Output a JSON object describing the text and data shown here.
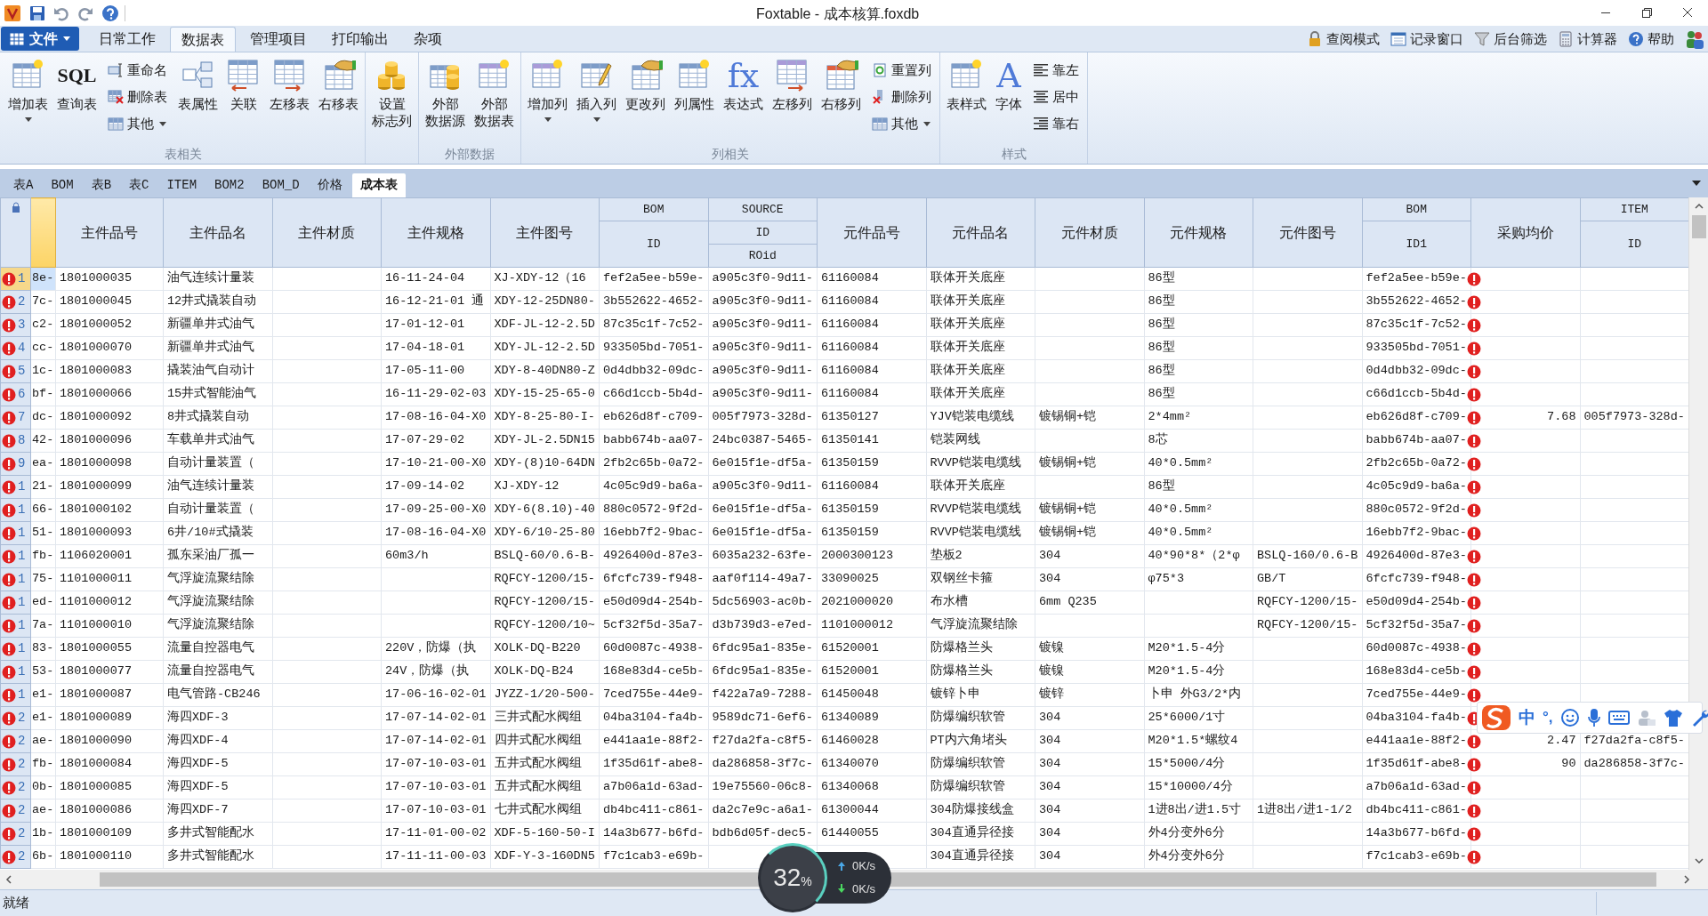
{
  "window": {
    "title": "Foxtable - 成本核算.foxdb"
  },
  "menu": {
    "file": "文件",
    "tabs": [
      {
        "label": "日常工作",
        "selected": false
      },
      {
        "label": "数据表",
        "selected": true
      },
      {
        "label": "管理项目",
        "selected": false
      },
      {
        "label": "打印输出",
        "selected": false
      },
      {
        "label": "杂项",
        "selected": false
      }
    ],
    "tools": [
      "查阅模式",
      "记录窗口",
      "后台筛选",
      "计算器",
      "帮助"
    ]
  },
  "ribbon": {
    "groups": [
      {
        "label": "表相关",
        "items": [
          {
            "kind": "large",
            "lines": [
              "增加表"
            ],
            "dropdown": true
          },
          {
            "kind": "large",
            "lines": [
              "查询表"
            ],
            "glyph": "SQL",
            "dropdown": false
          },
          {
            "kind": "stack",
            "items": [
              {
                "label": "重命名",
                "dropdown": false
              },
              {
                "label": "删除表",
                "dropdown": false
              },
              {
                "label": "其他",
                "dropdown": true
              }
            ]
          },
          {
            "kind": "large",
            "lines": [
              "表属性"
            ],
            "dropdown": false
          },
          {
            "kind": "large",
            "lines": [
              "关联"
            ],
            "dropdown": false
          },
          {
            "kind": "large",
            "lines": [
              "左移表"
            ],
            "dropdown": false
          },
          {
            "kind": "large",
            "lines": [
              "右移表"
            ],
            "dropdown": false
          }
        ]
      },
      {
        "items": [
          {
            "kind": "large",
            "lines": [
              "设置",
              "标志列"
            ],
            "dropdown": false
          }
        ]
      },
      {
        "label": "外部数据",
        "items": [
          {
            "kind": "large",
            "lines": [
              "外部",
              "数据源"
            ],
            "dropdown": false
          },
          {
            "kind": "large",
            "lines": [
              "外部",
              "数据表"
            ],
            "dropdown": false
          }
        ]
      },
      {
        "label": "列相关",
        "items": [
          {
            "kind": "large",
            "lines": [
              "增加列"
            ],
            "dropdown": true
          },
          {
            "kind": "large",
            "lines": [
              "插入列"
            ],
            "dropdown": true
          },
          {
            "kind": "large",
            "lines": [
              "更改列"
            ],
            "dropdown": false
          },
          {
            "kind": "large",
            "lines": [
              "列属性"
            ],
            "dropdown": false
          },
          {
            "kind": "large",
            "lines": [
              "表达式"
            ],
            "glyph": "fx",
            "dropdown": false
          },
          {
            "kind": "large",
            "lines": [
              "左移列"
            ],
            "dropdown": false
          },
          {
            "kind": "large",
            "lines": [
              "右移列"
            ],
            "dropdown": false
          },
          {
            "kind": "stack",
            "items": [
              {
                "label": "重置列",
                "dropdown": false
              },
              {
                "label": "删除列",
                "dropdown": false
              },
              {
                "label": "其他",
                "dropdown": true
              }
            ]
          }
        ]
      },
      {
        "label": "样式",
        "items": [
          {
            "kind": "large",
            "lines": [
              "表样式"
            ],
            "dropdown": false
          },
          {
            "kind": "large",
            "lines": [
              "字体"
            ],
            "glyph": "A",
            "dropdown": false
          },
          {
            "kind": "stack",
            "items": [
              {
                "label": "靠左",
                "dropdown": false
              },
              {
                "label": "居中",
                "dropdown": false
              },
              {
                "label": "靠右",
                "dropdown": false
              }
            ]
          }
        ]
      }
    ]
  },
  "sheet_tabs": [
    {
      "label": "表A",
      "selected": false
    },
    {
      "label": "BOM",
      "selected": false
    },
    {
      "label": "表B",
      "selected": false
    },
    {
      "label": "表C",
      "selected": false
    },
    {
      "label": "ITEM",
      "selected": false
    },
    {
      "label": "BOM2",
      "selected": false
    },
    {
      "label": "BOM_D",
      "selected": false
    },
    {
      "label": "价格",
      "selected": false
    },
    {
      "label": "成本表",
      "selected": true
    }
  ],
  "table": {
    "columns": [
      {
        "selected": true
      },
      {
        "label": "主件品号",
        "selected": false
      },
      {
        "label": "主件品名",
        "selected": false
      },
      {
        "label": "主件材质",
        "selected": false
      },
      {
        "label": "主件规格",
        "selected": false
      },
      {
        "label": "主件图号",
        "selected": false
      },
      {
        "group": "BOM",
        "label": "ID",
        "selected": false
      },
      {
        "group": "SOURCE",
        "label": "ID",
        "sublabel": "ROid",
        "selected": false
      },
      {
        "label": "元件品号",
        "selected": false
      },
      {
        "label": "元件品名",
        "selected": false
      },
      {
        "label": "元件材质",
        "selected": false
      },
      {
        "label": "元件规格",
        "selected": false
      },
      {
        "label": "元件图号",
        "selected": false
      },
      {
        "group": "BOM",
        "label": "ID1",
        "selected": false
      },
      {
        "label": "采购均价",
        "selected": false
      },
      {
        "group": "ITEM",
        "label": "ID",
        "selected": false
      }
    ],
    "rows": [
      {
        "num": "1",
        "selected": true,
        "invalid": true,
        "cells": [
          "8e-",
          "1801000035",
          "油气连续计量装",
          null,
          "16-11-24-04",
          "XJ-XDY-12（16",
          "fef2a5ee-b59e-",
          "a905c3f0-9d11-",
          "61160084",
          "联体开关底座",
          null,
          "86型",
          null,
          "fef2a5ee-b59e-",
          null,
          null
        ]
      },
      {
        "num": "2",
        "selected": false,
        "invalid": true,
        "cells": [
          "7c-",
          "1801000045",
          "12井式撬装自动",
          null,
          "16-12-21-01 通",
          "XDY-12-25DN80-",
          "3b552622-4652-",
          "a905c3f0-9d11-",
          "61160084",
          "联体开关底座",
          null,
          "86型",
          null,
          "3b552622-4652-",
          null,
          null
        ]
      },
      {
        "num": "3",
        "selected": false,
        "invalid": true,
        "cells": [
          "c2-",
          "1801000052",
          "新疆单井式油气",
          null,
          "17-01-12-01",
          "XDF-JL-12-2.5D",
          "87c35c1f-7c52-",
          "a905c3f0-9d11-",
          "61160084",
          "联体开关底座",
          null,
          "86型",
          null,
          "87c35c1f-7c52-",
          null,
          null
        ]
      },
      {
        "num": "4",
        "selected": false,
        "invalid": true,
        "cells": [
          "cc-",
          "1801000070",
          "新疆单井式油气",
          null,
          "17-04-18-01",
          "XDY-JL-12-2.5D",
          "933505bd-7051-",
          "a905c3f0-9d11-",
          "61160084",
          "联体开关底座",
          null,
          "86型",
          null,
          "933505bd-7051-",
          null,
          null
        ]
      },
      {
        "num": "5",
        "selected": false,
        "invalid": true,
        "cells": [
          "1c-",
          "1801000083",
          "撬装油气自动计",
          null,
          "17-05-11-00",
          "XDY-8-40DN80-Z",
          "0d4dbb32-09dc-",
          "a905c3f0-9d11-",
          "61160084",
          "联体开关底座",
          null,
          "86型",
          null,
          "0d4dbb32-09dc-",
          null,
          null
        ]
      },
      {
        "num": "6",
        "selected": false,
        "invalid": true,
        "cells": [
          "bf-",
          "1801000066",
          "15井式智能油气",
          null,
          "16-11-29-02-03",
          "XDY-15-25-65-0",
          "c66d1ccb-5b4d-",
          "a905c3f0-9d11-",
          "61160084",
          "联体开关底座",
          null,
          "86型",
          null,
          "c66d1ccb-5b4d-",
          null,
          null
        ]
      },
      {
        "num": "7",
        "selected": false,
        "invalid": true,
        "cells": [
          "dc-",
          "1801000092",
          "8井式撬装自动",
          null,
          "17-08-16-04-X0",
          "XDY-8-25-80-I-",
          "eb626d8f-c709-",
          "005f7973-328d-",
          "61350127",
          "YJV铠装电缆线",
          "镀锡铜+铠",
          "2*4mm²",
          null,
          "eb626d8f-c709-",
          "7.68",
          "005f7973-328d-"
        ]
      },
      {
        "num": "8",
        "selected": false,
        "invalid": true,
        "cells": [
          "42-",
          "1801000096",
          "车载单井式油气",
          null,
          "17-07-29-02",
          "XDY-JL-2.5DN15",
          "babb674b-aa07-",
          "24bc0387-5465-",
          "61350141",
          "铠装网线",
          null,
          "8芯",
          null,
          "babb674b-aa07-",
          null,
          null
        ]
      },
      {
        "num": "9",
        "selected": false,
        "invalid": true,
        "cells": [
          "ea-",
          "1801000098",
          "自动计量装置（",
          null,
          "17-10-21-00-X0",
          "XDY-(8)10-64DN",
          "2fb2c65b-0a72-",
          "6e015f1e-df5a-",
          "61350159",
          "RVVP铠装电缆线",
          "镀锡铜+铠",
          "40*0.5mm²",
          null,
          "2fb2c65b-0a72-",
          null,
          null
        ]
      },
      {
        "num": "1",
        "selected": false,
        "invalid": true,
        "cells": [
          "21-",
          "1801000099",
          "油气连续计量装",
          null,
          "17-09-14-02",
          "XJ-XDY-12",
          "4c05c9d9-ba6a-",
          "a905c3f0-9d11-",
          "61160084",
          "联体开关底座",
          null,
          "86型",
          null,
          "4c05c9d9-ba6a-",
          null,
          null
        ]
      },
      {
        "num": "1",
        "selected": false,
        "invalid": true,
        "cells": [
          "66-",
          "1801000102",
          "自动计量装置（",
          null,
          "17-09-25-00-X0",
          "XDY-6(8.10)-40",
          "880c0572-9f2d-",
          "6e015f1e-df5a-",
          "61350159",
          "RVVP铠装电缆线",
          "镀锡铜+铠",
          "40*0.5mm²",
          null,
          "880c0572-9f2d-",
          null,
          null
        ]
      },
      {
        "num": "1",
        "selected": false,
        "invalid": true,
        "cells": [
          "51-",
          "1801000093",
          "6井/10#式撬装",
          null,
          "17-08-16-04-X0",
          "XDY-6/10-25-80",
          "16ebb7f2-9bac-",
          "6e015f1e-df5a-",
          "61350159",
          "RVVP铠装电缆线",
          "镀锡铜+铠",
          "40*0.5mm²",
          null,
          "16ebb7f2-9bac-",
          null,
          null
        ]
      },
      {
        "num": "1",
        "selected": false,
        "invalid": true,
        "cells": [
          "fb-",
          "1106020001",
          "孤东采油厂孤一",
          null,
          "60m3/h",
          "BSLQ-60/0.6-B-",
          "4926400d-87e3-",
          "6035a232-63fe-",
          "2000300123",
          "垫板2",
          "304",
          "40*90*8*（2*φ",
          "BSLQ-160/0.6-B",
          "4926400d-87e3-",
          null,
          null
        ]
      },
      {
        "num": "1",
        "selected": false,
        "invalid": true,
        "cells": [
          "75-",
          "1101000011",
          "气浮旋流聚结除",
          null,
          null,
          "RQFCY-1200/15-",
          "6fcfc739-f948-",
          "aaf0f114-49a7-",
          "33090025",
          "双钢丝卡箍",
          "304",
          "φ75*3",
          "GB/T",
          "6fcfc739-f948-",
          null,
          null
        ]
      },
      {
        "num": "1",
        "selected": false,
        "invalid": true,
        "cells": [
          "ed-",
          "1101000012",
          "气浮旋流聚结除",
          null,
          null,
          "RQFCY-1200/15-",
          "e50d09d4-254b-",
          "5dc56903-ac0b-",
          "2021000020",
          "布水槽",
          "6mm Q235",
          null,
          "RQFCY-1200/15-",
          "e50d09d4-254b-",
          null,
          null
        ]
      },
      {
        "num": "1",
        "selected": false,
        "invalid": true,
        "cells": [
          "7a-",
          "1101000010",
          "气浮旋流聚结除",
          null,
          null,
          "RQFCY-1200/10~",
          "5cf32f5d-35a7-",
          "d3b739d3-e7ed-",
          "1101000012",
          "气浮旋流聚结除",
          null,
          null,
          "RQFCY-1200/15-",
          "5cf32f5d-35a7-",
          null,
          null
        ]
      },
      {
        "num": "1",
        "selected": false,
        "invalid": true,
        "cells": [
          "83-",
          "1801000055",
          "流量自控器电气",
          null,
          "220V，防爆（执",
          "XOLK-DQ-B220",
          "60d0087c-4938-",
          "6fdc95a1-835e-",
          "61520001",
          "防爆格兰头",
          "镀镍",
          "M20*1.5-4分",
          null,
          "60d0087c-4938-",
          null,
          null
        ]
      },
      {
        "num": "1",
        "selected": false,
        "invalid": true,
        "cells": [
          "53-",
          "1801000077",
          "流量自控器电气",
          null,
          "24V，防爆（执",
          "XOLK-DQ-B24",
          "168e83d4-ce5b-",
          "6fdc95a1-835e-",
          "61520001",
          "防爆格兰头",
          "镀镍",
          "M20*1.5-4分",
          null,
          "168e83d4-ce5b-",
          null,
          null
        ]
      },
      {
        "num": "1",
        "selected": false,
        "invalid": true,
        "cells": [
          "e1-",
          "1801000087",
          "电气管路-CB246",
          null,
          "17-06-16-02-01",
          "JYZZ-1/20-500-",
          "7ced755e-44e9-",
          "f422a7a9-7288-",
          "61450048",
          "镀锌卜申",
          "镀锌",
          "卜申 外G3/2*内",
          null,
          "7ced755e-44e9-",
          null,
          null
        ]
      },
      {
        "num": "2",
        "selected": false,
        "invalid": true,
        "cells": [
          "e1-",
          "1801000089",
          "海四XDF-3",
          null,
          "17-07-14-02-01",
          "三井式配水阀组",
          "04ba3104-fa4b-",
          "9589dc71-6ef6-",
          "61340089",
          "防爆编织软管",
          "304",
          "25*6000/1寸",
          null,
          "04ba3104-fa4b-",
          null,
          null
        ]
      },
      {
        "num": "2",
        "selected": false,
        "invalid": true,
        "cells": [
          "ae-",
          "1801000090",
          "海四XDF-4",
          null,
          "17-07-14-02-01",
          "四井式配水阀组",
          "e441aa1e-88f2-",
          "f27da2fa-c8f5-",
          "61460028",
          "PT内六角堵头",
          "304",
          "M20*1.5*螺纹4",
          null,
          "e441aa1e-88f2-",
          "2.47",
          "f27da2fa-c8f5-"
        ]
      },
      {
        "num": "2",
        "selected": false,
        "invalid": true,
        "cells": [
          "fb-",
          "1801000084",
          "海四XDF-5",
          null,
          "17-07-10-03-01",
          "五井式配水阀组",
          "1f35d61f-abe8-",
          "da286858-3f7c-",
          "61340070",
          "防爆编织软管",
          "304",
          "15*5000/4分",
          null,
          "1f35d61f-abe8-",
          "90",
          "da286858-3f7c-"
        ]
      },
      {
        "num": "2",
        "selected": false,
        "invalid": true,
        "cells": [
          "0b-",
          "1801000085",
          "海四XDF-5",
          null,
          "17-07-10-03-01",
          "五井式配水阀组",
          "a7b06a1d-63ad-",
          "19e75560-06c8-",
          "61340068",
          "防爆编织软管",
          "304",
          "15*10000/4分",
          null,
          "a7b06a1d-63ad-",
          null,
          null
        ]
      },
      {
        "num": "2",
        "selected": false,
        "invalid": true,
        "cells": [
          "ae-",
          "1801000086",
          "海四XDF-7",
          null,
          "17-07-10-03-01",
          "七井式配水阀组",
          "db4bc411-c861-",
          "da2c7e9c-a6a1-",
          "61300044",
          "304防爆接线盒",
          "304",
          "1进8出/进1.5寸",
          "1进8出/进1-1/2",
          "db4bc411-c861-",
          null,
          null
        ]
      },
      {
        "num": "2",
        "selected": false,
        "invalid": true,
        "cells": [
          "1b-",
          "1801000109",
          "多井式智能配水",
          null,
          "17-11-01-00-02",
          "XDF-5-160-50-I",
          "14a3b677-b6fd-",
          "bdb6d05f-dec5-",
          "61440055",
          "304直通异径接",
          "304",
          "外4分变外6分",
          null,
          "14a3b677-b6fd-",
          null,
          null
        ]
      },
      {
        "num": "2",
        "selected": false,
        "invalid": true,
        "cells": [
          "6b-",
          "1801000110",
          "多井式智能配水",
          null,
          "17-11-11-00-03",
          "XDF-Y-3-160DN5",
          "f7c1cab3-e69b-",
          null,
          null,
          "304直通异径接",
          "304",
          "外4分变外6分",
          null,
          "f7c1cab3-e69b-",
          null,
          null
        ]
      }
    ]
  },
  "status_bar": {
    "text": "就绪"
  },
  "net_meter": {
    "value": "32",
    "unit": "%",
    "upload": "0K/s",
    "download": "0K/s"
  },
  "ime_toolbar": {
    "mode": "中",
    "punct": "°,"
  }
}
